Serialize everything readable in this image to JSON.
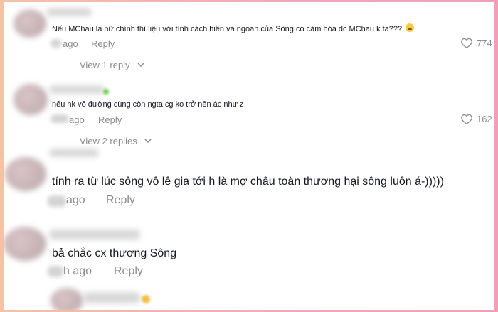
{
  "comments": [
    {
      "text": "Nếu MChau là nữ chính thì liệu với tính cách hiền và ngoan của Sông có cảm hóa dc MChau k ta???",
      "time_visible": "ago",
      "reply_label": "Reply",
      "like_count": "774",
      "view_replies": "View 1 reply"
    },
    {
      "text": "nếu hk vô đường cùng còn ngta cg ko trở nên ác như z",
      "time_visible": "ago",
      "reply_label": "Reply",
      "like_count": "162",
      "view_replies": "View 2 replies"
    },
    {
      "text": "tính ra từ lúc sông vô lê gia tới h là mợ châu toàn thương hại sông luôn á-)))))",
      "time_visible": "ago",
      "reply_label": "Reply"
    },
    {
      "text": "bả chắc cx thương Sông",
      "time_visible": "h ago",
      "reply_label": "Reply"
    }
  ],
  "icons": {
    "emoji": "thinking-face-emoji",
    "like": "heart-outline-icon",
    "chevron": "chevron-down-icon"
  },
  "colors": {
    "text": "#161823",
    "secondary": "#8a8b91",
    "frame_gradient_start": "#f6c2a4",
    "frame_gradient_end": "#f0a0b6"
  }
}
